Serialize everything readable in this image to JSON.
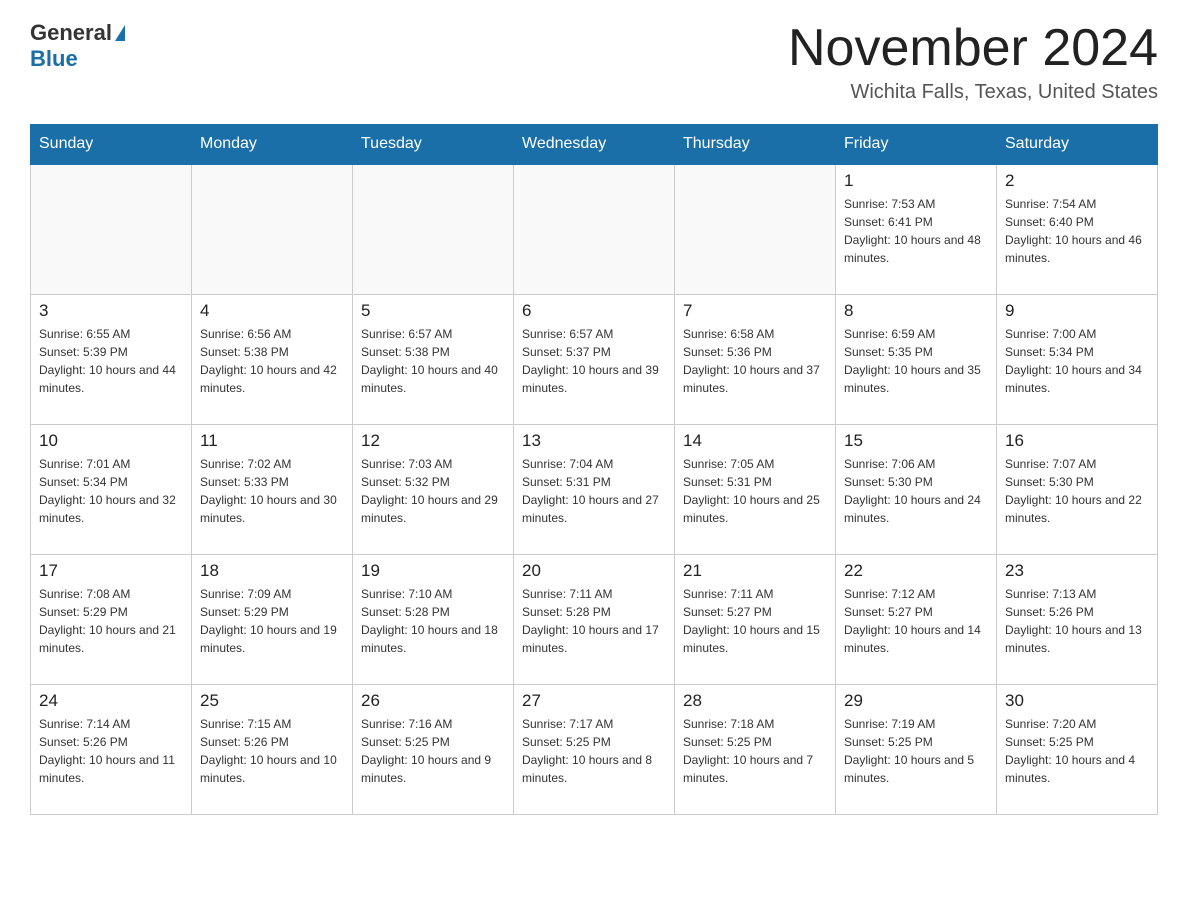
{
  "header": {
    "logo_general": "General",
    "logo_blue": "Blue",
    "month_title": "November 2024",
    "location": "Wichita Falls, Texas, United States"
  },
  "days_of_week": [
    "Sunday",
    "Monday",
    "Tuesday",
    "Wednesday",
    "Thursday",
    "Friday",
    "Saturday"
  ],
  "weeks": [
    [
      {
        "day": "",
        "sunrise": "",
        "sunset": "",
        "daylight": ""
      },
      {
        "day": "",
        "sunrise": "",
        "sunset": "",
        "daylight": ""
      },
      {
        "day": "",
        "sunrise": "",
        "sunset": "",
        "daylight": ""
      },
      {
        "day": "",
        "sunrise": "",
        "sunset": "",
        "daylight": ""
      },
      {
        "day": "",
        "sunrise": "",
        "sunset": "",
        "daylight": ""
      },
      {
        "day": "1",
        "sunrise": "Sunrise: 7:53 AM",
        "sunset": "Sunset: 6:41 PM",
        "daylight": "Daylight: 10 hours and 48 minutes."
      },
      {
        "day": "2",
        "sunrise": "Sunrise: 7:54 AM",
        "sunset": "Sunset: 6:40 PM",
        "daylight": "Daylight: 10 hours and 46 minutes."
      }
    ],
    [
      {
        "day": "3",
        "sunrise": "Sunrise: 6:55 AM",
        "sunset": "Sunset: 5:39 PM",
        "daylight": "Daylight: 10 hours and 44 minutes."
      },
      {
        "day": "4",
        "sunrise": "Sunrise: 6:56 AM",
        "sunset": "Sunset: 5:38 PM",
        "daylight": "Daylight: 10 hours and 42 minutes."
      },
      {
        "day": "5",
        "sunrise": "Sunrise: 6:57 AM",
        "sunset": "Sunset: 5:38 PM",
        "daylight": "Daylight: 10 hours and 40 minutes."
      },
      {
        "day": "6",
        "sunrise": "Sunrise: 6:57 AM",
        "sunset": "Sunset: 5:37 PM",
        "daylight": "Daylight: 10 hours and 39 minutes."
      },
      {
        "day": "7",
        "sunrise": "Sunrise: 6:58 AM",
        "sunset": "Sunset: 5:36 PM",
        "daylight": "Daylight: 10 hours and 37 minutes."
      },
      {
        "day": "8",
        "sunrise": "Sunrise: 6:59 AM",
        "sunset": "Sunset: 5:35 PM",
        "daylight": "Daylight: 10 hours and 35 minutes."
      },
      {
        "day": "9",
        "sunrise": "Sunrise: 7:00 AM",
        "sunset": "Sunset: 5:34 PM",
        "daylight": "Daylight: 10 hours and 34 minutes."
      }
    ],
    [
      {
        "day": "10",
        "sunrise": "Sunrise: 7:01 AM",
        "sunset": "Sunset: 5:34 PM",
        "daylight": "Daylight: 10 hours and 32 minutes."
      },
      {
        "day": "11",
        "sunrise": "Sunrise: 7:02 AM",
        "sunset": "Sunset: 5:33 PM",
        "daylight": "Daylight: 10 hours and 30 minutes."
      },
      {
        "day": "12",
        "sunrise": "Sunrise: 7:03 AM",
        "sunset": "Sunset: 5:32 PM",
        "daylight": "Daylight: 10 hours and 29 minutes."
      },
      {
        "day": "13",
        "sunrise": "Sunrise: 7:04 AM",
        "sunset": "Sunset: 5:31 PM",
        "daylight": "Daylight: 10 hours and 27 minutes."
      },
      {
        "day": "14",
        "sunrise": "Sunrise: 7:05 AM",
        "sunset": "Sunset: 5:31 PM",
        "daylight": "Daylight: 10 hours and 25 minutes."
      },
      {
        "day": "15",
        "sunrise": "Sunrise: 7:06 AM",
        "sunset": "Sunset: 5:30 PM",
        "daylight": "Daylight: 10 hours and 24 minutes."
      },
      {
        "day": "16",
        "sunrise": "Sunrise: 7:07 AM",
        "sunset": "Sunset: 5:30 PM",
        "daylight": "Daylight: 10 hours and 22 minutes."
      }
    ],
    [
      {
        "day": "17",
        "sunrise": "Sunrise: 7:08 AM",
        "sunset": "Sunset: 5:29 PM",
        "daylight": "Daylight: 10 hours and 21 minutes."
      },
      {
        "day": "18",
        "sunrise": "Sunrise: 7:09 AM",
        "sunset": "Sunset: 5:29 PM",
        "daylight": "Daylight: 10 hours and 19 minutes."
      },
      {
        "day": "19",
        "sunrise": "Sunrise: 7:10 AM",
        "sunset": "Sunset: 5:28 PM",
        "daylight": "Daylight: 10 hours and 18 minutes."
      },
      {
        "day": "20",
        "sunrise": "Sunrise: 7:11 AM",
        "sunset": "Sunset: 5:28 PM",
        "daylight": "Daylight: 10 hours and 17 minutes."
      },
      {
        "day": "21",
        "sunrise": "Sunrise: 7:11 AM",
        "sunset": "Sunset: 5:27 PM",
        "daylight": "Daylight: 10 hours and 15 minutes."
      },
      {
        "day": "22",
        "sunrise": "Sunrise: 7:12 AM",
        "sunset": "Sunset: 5:27 PM",
        "daylight": "Daylight: 10 hours and 14 minutes."
      },
      {
        "day": "23",
        "sunrise": "Sunrise: 7:13 AM",
        "sunset": "Sunset: 5:26 PM",
        "daylight": "Daylight: 10 hours and 13 minutes."
      }
    ],
    [
      {
        "day": "24",
        "sunrise": "Sunrise: 7:14 AM",
        "sunset": "Sunset: 5:26 PM",
        "daylight": "Daylight: 10 hours and 11 minutes."
      },
      {
        "day": "25",
        "sunrise": "Sunrise: 7:15 AM",
        "sunset": "Sunset: 5:26 PM",
        "daylight": "Daylight: 10 hours and 10 minutes."
      },
      {
        "day": "26",
        "sunrise": "Sunrise: 7:16 AM",
        "sunset": "Sunset: 5:25 PM",
        "daylight": "Daylight: 10 hours and 9 minutes."
      },
      {
        "day": "27",
        "sunrise": "Sunrise: 7:17 AM",
        "sunset": "Sunset: 5:25 PM",
        "daylight": "Daylight: 10 hours and 8 minutes."
      },
      {
        "day": "28",
        "sunrise": "Sunrise: 7:18 AM",
        "sunset": "Sunset: 5:25 PM",
        "daylight": "Daylight: 10 hours and 7 minutes."
      },
      {
        "day": "29",
        "sunrise": "Sunrise: 7:19 AM",
        "sunset": "Sunset: 5:25 PM",
        "daylight": "Daylight: 10 hours and 5 minutes."
      },
      {
        "day": "30",
        "sunrise": "Sunrise: 7:20 AM",
        "sunset": "Sunset: 5:25 PM",
        "daylight": "Daylight: 10 hours and 4 minutes."
      }
    ]
  ]
}
